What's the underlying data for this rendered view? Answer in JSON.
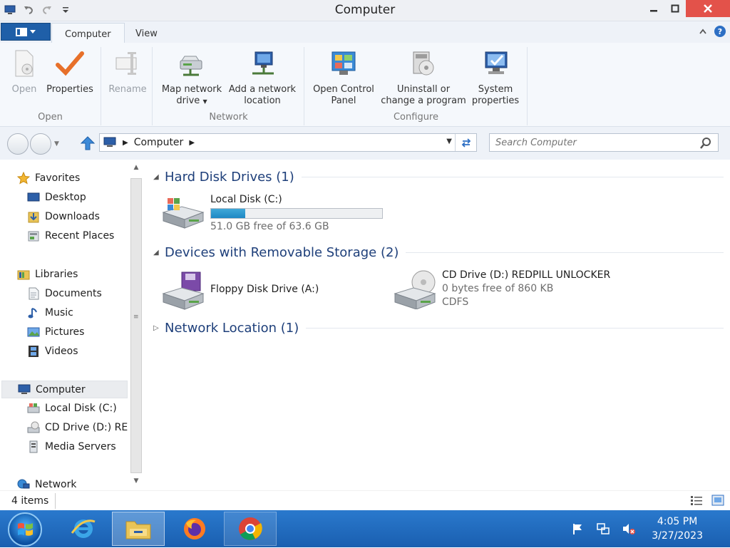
{
  "window": {
    "title": "Computer"
  },
  "ribbon": {
    "file_tab": "",
    "tabs": [
      {
        "label": "Computer"
      },
      {
        "label": "View"
      }
    ],
    "groups": {
      "open": {
        "label": "Open",
        "open_btn": "Open",
        "properties_btn": "Properties",
        "rename_btn": "Rename"
      },
      "network": {
        "label": "Network",
        "map_drive_l1": "Map network",
        "map_drive_l2": "drive",
        "add_location_l1": "Add a network",
        "add_location_l2": "location"
      },
      "configure": {
        "label": "Configure",
        "control_panel_l1": "Open Control",
        "control_panel_l2": "Panel",
        "uninstall_l1": "Uninstall or",
        "uninstall_l2": "change a program",
        "system_l1": "System",
        "system_l2": "properties"
      }
    }
  },
  "address": {
    "crumb": "Computer"
  },
  "search": {
    "placeholder": "Search Computer"
  },
  "nav": {
    "favorites": "Favorites",
    "desktop": "Desktop",
    "downloads": "Downloads",
    "recent": "Recent Places",
    "libraries": "Libraries",
    "documents": "Documents",
    "music": "Music",
    "pictures": "Pictures",
    "videos": "Videos",
    "computer": "Computer",
    "local_disk": "Local Disk (C:)",
    "cd_drive": "CD Drive (D:) REDPILL UNLOCKER",
    "media_servers": "Media Servers",
    "network": "Network"
  },
  "content": {
    "hdd_group": "Hard Disk Drives (1)",
    "removable_group": "Devices with Removable Storage (2)",
    "network_group": "Network Location (1)",
    "local_disk": {
      "name": "Local Disk (C:)",
      "free": "51.0 GB free of 63.6 GB",
      "used_fraction": 0.198
    },
    "floppy": {
      "name": "Floppy Disk Drive (A:)"
    },
    "cd": {
      "name": "CD Drive (D:) REDPILL UNLOCKER",
      "free": "0 bytes free of 860 KB",
      "fs": "CDFS"
    }
  },
  "status": {
    "count": "4 items"
  },
  "taskbar": {
    "time": "4:05 PM",
    "date": "3/27/2023"
  },
  "colors": {
    "accent": "#1e3f7a",
    "taskbar": "#1f6cc0",
    "close": "#e3524a",
    "progress": "#1e88c4"
  }
}
